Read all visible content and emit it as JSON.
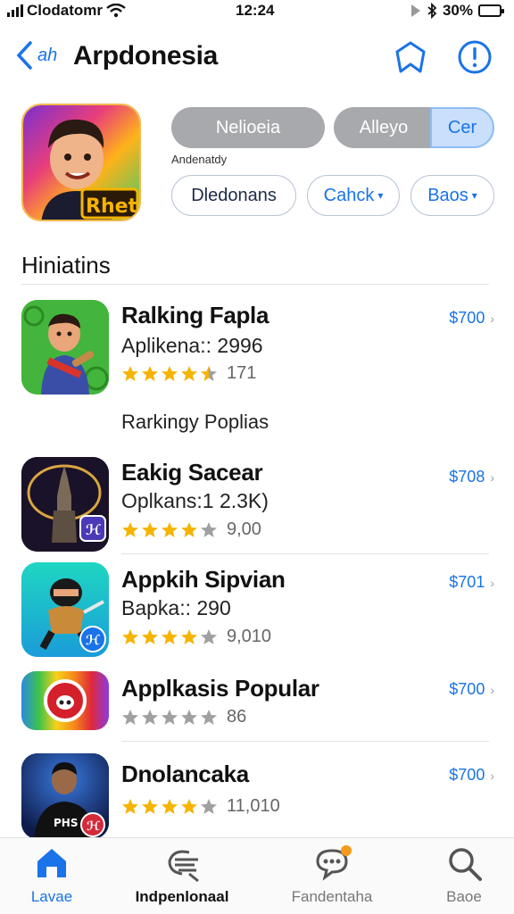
{
  "status_bar": {
    "carrier": "Clodatomr",
    "time": "12:24",
    "battery": "30%",
    "battery_level": 0.3
  },
  "nav": {
    "title": "Arpdonesia"
  },
  "header": {
    "segment_buttons": [
      "Nelioeia",
      "Alleyo",
      "Cer"
    ],
    "tiny_label": "Andenatdy",
    "filter_buttons": [
      "Dledonans",
      "Cahck",
      "Baos"
    ]
  },
  "section_title": "Hiniatins",
  "apps": [
    {
      "name": "Ralking Fapla",
      "subtitle": "Aplikena:: 2996",
      "stars": 4.5,
      "rating_count": "171",
      "price": "$700"
    },
    {
      "name": "Eakig Sacear",
      "subtitle": "Oplkans:1 2.3K)",
      "stars": 4,
      "rating_count": "9,00",
      "price": "$708"
    },
    {
      "name": "Appkih Sipvian",
      "subtitle": "Bapka:: 290",
      "stars": 4,
      "rating_count": "9,010",
      "price": "$701"
    },
    {
      "name": "Applkasis Popular",
      "subtitle": "",
      "stars": 0,
      "rating_count": "86",
      "price": "$700"
    },
    {
      "name": "Dnolancaka",
      "subtitle": "",
      "stars": 4,
      "rating_count": "11,010",
      "price": "$700"
    }
  ],
  "list_label": "Rarkingy Poplias",
  "tabs": [
    {
      "label": "Lavae",
      "icon": "home-icon",
      "active": true
    },
    {
      "label": "Indpenlonaal",
      "icon": "list-icon",
      "active": false
    },
    {
      "label": "Fandentaha",
      "icon": "chat-icon",
      "active": false
    },
    {
      "label": "Baoe",
      "icon": "search-icon",
      "active": false
    }
  ],
  "colors": {
    "accent": "#1a73e8",
    "star": "#f5b400",
    "star_empty": "#a0a0a0"
  }
}
